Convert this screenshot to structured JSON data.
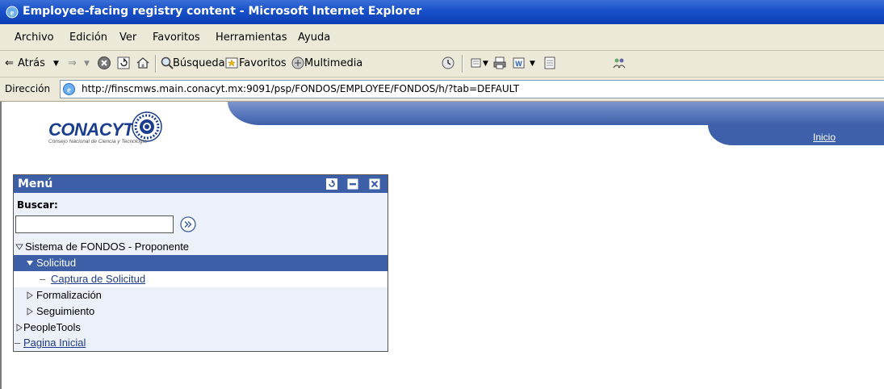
{
  "window": {
    "title": "Employee-facing registry content - Microsoft Internet Explorer"
  },
  "menubar": {
    "items": [
      "Archivo",
      "Edición",
      "Ver",
      "Favoritos",
      "Herramientas",
      "Ayuda"
    ]
  },
  "toolbar": {
    "back_label": "Atrás",
    "search_label": "Búsqueda",
    "favorites_label": "Favoritos",
    "multimedia_label": "Multimedia"
  },
  "address": {
    "label": "Dirección",
    "url": "http://finscmws.main.conacyt.mx:9091/psp/FONDOS/EMPLOYEE/FONDOS/h/?tab=DEFAULT"
  },
  "banner": {
    "logo_text": "CONACYT",
    "logo_subtitle": "Consejo Nacional de Ciencia y Tecnología",
    "inicio_link": "Inicio"
  },
  "menu": {
    "title": "Menú",
    "search_label": "Buscar:",
    "search_value": "",
    "tree": {
      "root": "Sistema de FONDOS - Proponente",
      "solicitud": "Solicitud",
      "captura": "Captura de Solicitud",
      "formalizacion": "Formalización",
      "seguimiento": "Seguimiento",
      "peopletools": "PeopleTools",
      "pagina_inicial": "Pagina Inicial"
    }
  },
  "colors": {
    "title_bar": "#1750c8",
    "chrome": "#ece9d8",
    "portlet_header": "#3d5fa8",
    "portlet_body": "#ebf0f9",
    "link": "#1f3a8a"
  }
}
